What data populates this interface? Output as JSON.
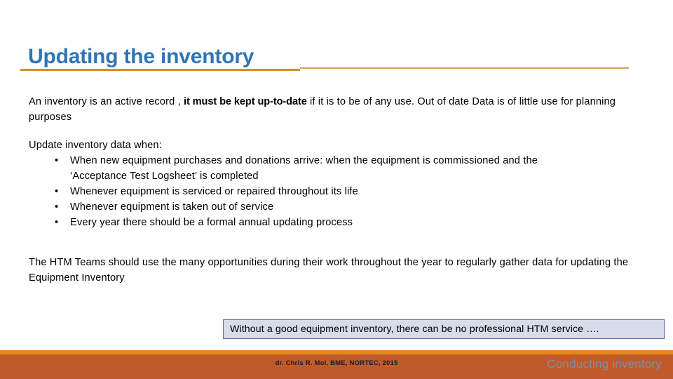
{
  "slide": {
    "title": "Updating the inventory",
    "title_color": "#2E75B6",
    "background_color": "#FFFFFF",
    "divider_color_left": "#C8912F",
    "divider_color_right": "#D6A24A"
  },
  "paragraph_1": {
    "part_a": "An inventory is an active record , ",
    "emphasis": "it must be kept up-to-date",
    "part_b": " if it is to be of any use. Out of date Data is of little use for planning purposes"
  },
  "paragraph_2": {
    "lead": "Update inventory data when:",
    "bullet_marker": "•",
    "bullets": [
      {
        "line1": "When new equipment purchases and donations arrive: when the equipment is commissioned and the",
        "line2": "‘Acceptance Test Logsheet’ is completed"
      },
      {
        "line1": "Whenever equipment is serviced or repaired throughout its life",
        "line2": ""
      },
      {
        "line1": "Whenever equipment is taken out of service",
        "line2": ""
      },
      {
        "line1": "Every year there should be a formal annual updating process",
        "line2": ""
      }
    ]
  },
  "paragraph_3": {
    "text": "The HTM Teams should use the many opportunities during their work throughout the year to regularly gather data for updating the Equipment Inventory"
  },
  "callout": {
    "text": "Without a good equipment inventory, there can be no professional HTM service ….",
    "fill_color": "#D6DCEA",
    "border_color": "#7B5EA7"
  },
  "footer": {
    "credit": "dr. Chris R. Mol, BME, NORTEC, 2015",
    "section_label": "Conducting inventory",
    "stripe_color": "#E8871B",
    "band_color": "#C05A2B",
    "section_label_color": "#7E8FA6"
  }
}
